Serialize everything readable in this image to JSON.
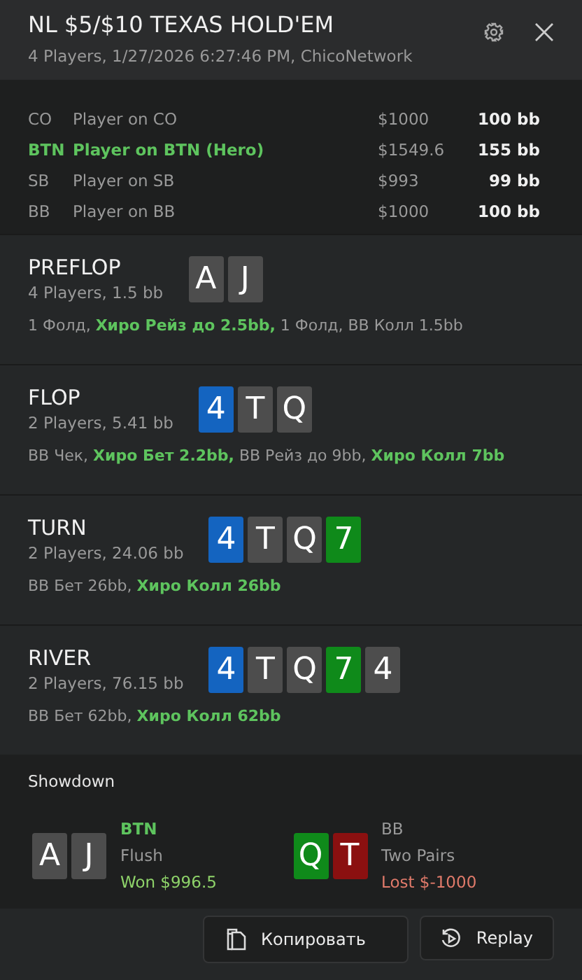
{
  "header": {
    "title": "NL $5/$10 TEXAS HOLD'EM",
    "subtitle": "4 Players, 1/27/2026 6:27:46 PM, ChicoNetwork"
  },
  "players": [
    {
      "position": "CO",
      "name": "Player on CO",
      "stack": "$1000",
      "bb": "100 bb",
      "hero": false
    },
    {
      "position": "BTN",
      "name": "Player on BTN (Hero)",
      "stack": "$1549.6",
      "bb": "155 bb",
      "hero": true
    },
    {
      "position": "SB",
      "name": "Player on SB",
      "stack": "$993",
      "bb": "99 bb",
      "hero": false
    },
    {
      "position": "BB",
      "name": "Player on BB",
      "stack": "$1000",
      "bb": "100 bb",
      "hero": false
    }
  ],
  "streets": [
    {
      "name": "PREFLOP",
      "info": "4 Players, 1.5 bb",
      "cards": [
        {
          "rank": "A",
          "color": "#4d4d4d"
        },
        {
          "rank": "J",
          "color": "#4d4d4d"
        }
      ],
      "actions": "1 Фолд, **Хиро Рейз до 2.5bb,** 1 Фолд, BB Колл 1.5bb"
    },
    {
      "name": "FLOP",
      "info": "2 Players, 5.41 bb",
      "cards": [
        {
          "rank": "4",
          "color": "#1464c0"
        },
        {
          "rank": "T",
          "color": "#4d4d4d"
        },
        {
          "rank": "Q",
          "color": "#4d4d4d"
        }
      ],
      "actions": "BB Чек, **Хиро Бет 2.2bb,** BB Рейз до 9bb, **Хиро Колл 7bb**"
    },
    {
      "name": "TURN",
      "info": "2 Players, 24.06 bb",
      "cards": [
        {
          "rank": "4",
          "color": "#1464c0"
        },
        {
          "rank": "T",
          "color": "#4d4d4d"
        },
        {
          "rank": "Q",
          "color": "#4d4d4d"
        },
        {
          "rank": "7",
          "color": "#0f8a1a"
        }
      ],
      "actions": "BB Бет 26bb, **Хиро Колл 26bb**"
    },
    {
      "name": "RIVER",
      "info": "2 Players, 76.15 bb",
      "cards": [
        {
          "rank": "4",
          "color": "#1464c0"
        },
        {
          "rank": "T",
          "color": "#4d4d4d"
        },
        {
          "rank": "Q",
          "color": "#4d4d4d"
        },
        {
          "rank": "7",
          "color": "#0f8a1a"
        },
        {
          "rank": "4",
          "color": "#4d4d4d"
        }
      ],
      "actions": "BB Бет 62bb, **Хиро Колл 62bb**"
    }
  ],
  "showdown": {
    "title": "Showdown",
    "hands": [
      {
        "position": "BTN",
        "hero": true,
        "cards": [
          {
            "rank": "A",
            "color": "#4d4d4d"
          },
          {
            "rank": "J",
            "color": "#4d4d4d"
          }
        ],
        "hand": "Flush",
        "result": "Won $996.5",
        "kind": "won"
      },
      {
        "position": "BB",
        "hero": false,
        "cards": [
          {
            "rank": "Q",
            "color": "#0f8a1a"
          },
          {
            "rank": "T",
            "color": "#8b1010"
          }
        ],
        "hand": "Two Pairs",
        "result": "Lost $-1000",
        "kind": "lost"
      }
    ]
  },
  "buttons": [
    {
      "label": "Копировать",
      "kind": "copy"
    },
    {
      "label": "Replay",
      "kind": "replay"
    }
  ]
}
